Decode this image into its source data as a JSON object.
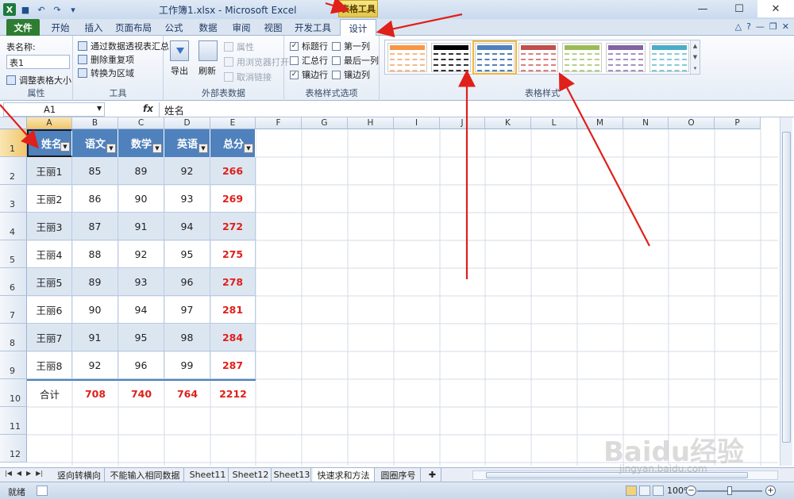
{
  "window": {
    "title": "工作簿1.xlsx - Microsoft Excel",
    "context_group": "表格工具"
  },
  "qat": {
    "logo": "X",
    "save": "■",
    "undo": "↶",
    "redo": "↷",
    "customize": "▾"
  },
  "winbtns": {
    "minimize": "—",
    "maximize": "☐",
    "close": "✕"
  },
  "tabs": [
    "文件",
    "开始",
    "插入",
    "页面布局",
    "公式",
    "数据",
    "审阅",
    "视图",
    "开发工具",
    "设计"
  ],
  "tabright": {
    "help": "?",
    "minimize": "—",
    "restore": "❐",
    "close": "✕",
    "caret": "△"
  },
  "ribbon": {
    "props": {
      "name_label": "表名称:",
      "name_value": "表1",
      "resize": "调整表格大小",
      "label": "属性"
    },
    "tools": {
      "pivot": "通过数据透视表汇总",
      "dedupe": "删除重复项",
      "convert": "转换为区域",
      "label": "工具"
    },
    "external": {
      "export": "导出",
      "refresh": "刷新",
      "properties": "属性",
      "open_browser": "用浏览器打开",
      "unlink": "取消链接",
      "label": "外部表数据"
    },
    "options": {
      "header_row": "标题行",
      "total_row": "汇总行",
      "banded_rows": "镶边行",
      "first_col": "第一列",
      "last_col": "最后一列",
      "banded_cols": "镶边列",
      "label": "表格样式选项"
    },
    "styles": {
      "label": "表格样式",
      "swatches": [
        {
          "hdr": "#f79646",
          "line": "#f5b98a"
        },
        {
          "hdr": "#000000",
          "line": "#333333"
        },
        {
          "hdr": "#4f81bd",
          "line": "#4f81bd"
        },
        {
          "hdr": "#c0504d",
          "line": "#d9817e"
        },
        {
          "hdr": "#9bbb59",
          "line": "#b7d08a"
        },
        {
          "hdr": "#8064a2",
          "line": "#a891c2"
        },
        {
          "hdr": "#4bacc6",
          "line": "#86cad9"
        }
      ]
    }
  },
  "formula_bar": {
    "cell": "A1",
    "fx": "fx",
    "value": "姓名"
  },
  "columns": [
    "A",
    "B",
    "C",
    "D",
    "E",
    "F",
    "G",
    "H",
    "I",
    "J",
    "K",
    "L",
    "M",
    "N",
    "O",
    "P"
  ],
  "rows": [
    "1",
    "2",
    "3",
    "4",
    "5",
    "6",
    "7",
    "8",
    "9",
    "10",
    "11",
    "12"
  ],
  "table": {
    "headers": [
      "姓名",
      "语文",
      "数学",
      "英语",
      "总分"
    ],
    "dropdown": "▼",
    "data": [
      [
        "王丽1",
        "85",
        "89",
        "92",
        "266"
      ],
      [
        "王丽2",
        "86",
        "90",
        "93",
        "269"
      ],
      [
        "王丽3",
        "87",
        "91",
        "94",
        "272"
      ],
      [
        "王丽4",
        "88",
        "92",
        "95",
        "275"
      ],
      [
        "王丽5",
        "89",
        "93",
        "96",
        "278"
      ],
      [
        "王丽6",
        "90",
        "94",
        "97",
        "281"
      ],
      [
        "王丽7",
        "91",
        "95",
        "98",
        "284"
      ],
      [
        "王丽8",
        "92",
        "96",
        "99",
        "287"
      ]
    ],
    "total": [
      "合计",
      "708",
      "740",
      "764",
      "2212"
    ]
  },
  "sheet_tabs": [
    "竖向转横向",
    "不能输入相同数据",
    "Sheet11",
    "Sheet12",
    "Sheet13",
    "快速求和方法",
    "圆圈序号"
  ],
  "status": {
    "ready": "就绪",
    "zoom": "100%"
  },
  "watermark": {
    "brand": "Baidu经验",
    "url": "jingyan.baidu.com"
  },
  "colors": {
    "accent": "#4f81bd",
    "band": "#dce6f1",
    "total_red": "#e0201a",
    "arrow": "#e0201a"
  }
}
